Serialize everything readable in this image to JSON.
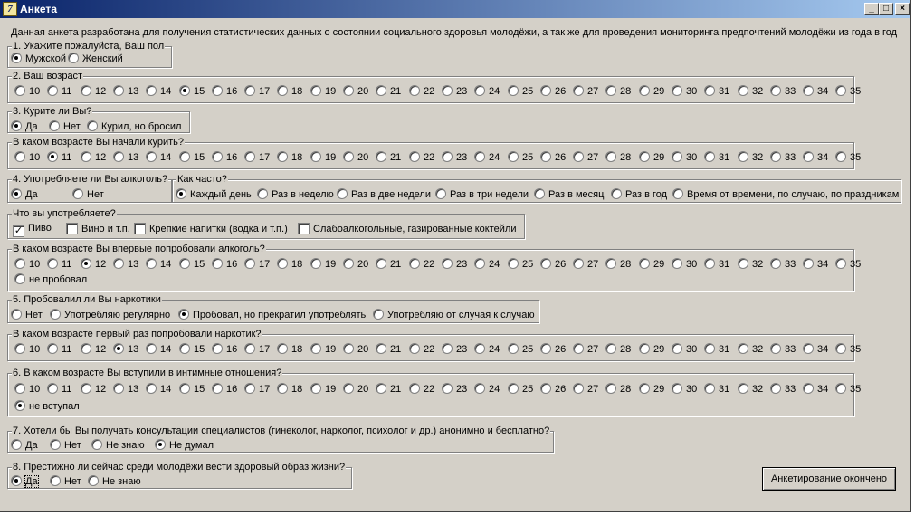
{
  "window": {
    "title": "Анкета",
    "min": "_",
    "max": "□",
    "close": "×"
  },
  "intro": "Данная анкета разработана для получения статистических данных о состоянии социального здоровья молодёжи, а так же для проведения мониторинга предпочтений молодёжи из года в год",
  "q1": {
    "title": "1. Укажите пожалуйста, Ваш пол",
    "options": [
      "Мужской",
      "Женский"
    ],
    "selected": 0
  },
  "q2": {
    "title": "2. Ваш возраст",
    "options": [
      "10",
      "11",
      "12",
      "13",
      "14",
      "15",
      "16",
      "17",
      "18",
      "19",
      "20",
      "21",
      "22",
      "23",
      "24",
      "25",
      "26",
      "27",
      "28",
      "29",
      "30",
      "31",
      "32",
      "33",
      "34",
      "35"
    ],
    "selected": 5
  },
  "q3": {
    "title": "3. Курите ли Вы?",
    "options": [
      "Да",
      "Нет",
      "Курил, но бросил"
    ],
    "selected": 0
  },
  "q3a": {
    "title": "В каком возрасте Вы начали курить?",
    "options": [
      "10",
      "11",
      "12",
      "13",
      "14",
      "15",
      "16",
      "17",
      "18",
      "19",
      "20",
      "21",
      "22",
      "23",
      "24",
      "25",
      "26",
      "27",
      "28",
      "29",
      "30",
      "31",
      "32",
      "33",
      "34",
      "35"
    ],
    "selected": 1
  },
  "q4": {
    "title": "4. Употребляете ли Вы алкоголь?",
    "options": [
      "Да",
      "Нет"
    ],
    "selected": 0
  },
  "q4a": {
    "title": "Как часто?",
    "options": [
      "Каждый день",
      "Раз в неделю",
      "Раз в две недели",
      "Раз в три недели",
      "Раз в месяц",
      "Раз в год",
      "Время от времени, по случаю, по праздникам"
    ],
    "selected": 0
  },
  "q4b": {
    "title": "Что вы употребляете?",
    "options": [
      {
        "label": "Пиво",
        "checked": true
      },
      {
        "label": "Вино и т.п.",
        "checked": false
      },
      {
        "label": "Крепкие напитки (водка и т.п.)",
        "checked": false
      },
      {
        "label": "Слабоалкогольные, газированные коктейли",
        "checked": false
      }
    ]
  },
  "q4c": {
    "title": "В каком возрасте Вы впервые попробовали алкоголь?",
    "options": [
      "10",
      "11",
      "12",
      "13",
      "14",
      "15",
      "16",
      "17",
      "18",
      "19",
      "20",
      "21",
      "22",
      "23",
      "24",
      "25",
      "26",
      "27",
      "28",
      "29",
      "30",
      "31",
      "32",
      "33",
      "34",
      "35"
    ],
    "extra": "не пробовал",
    "selected": 2
  },
  "q5": {
    "title": "5. Пробовалил ли Вы наркотики",
    "options": [
      "Нет",
      "Употребляю регулярно",
      "Пробовал, но прекратил употреблять",
      "Употребляю от случая к случаю"
    ],
    "selected": 2
  },
  "q5a": {
    "title": "В каком возрасте первый раз попробовали наркотик?",
    "options": [
      "10",
      "11",
      "12",
      "13",
      "14",
      "15",
      "16",
      "17",
      "18",
      "19",
      "20",
      "21",
      "22",
      "23",
      "24",
      "25",
      "26",
      "27",
      "28",
      "29",
      "30",
      "31",
      "32",
      "33",
      "34",
      "35"
    ],
    "selected": 3
  },
  "q6": {
    "title": "6. В каком возрасте Вы вступили в интимные отношения?",
    "options": [
      "10",
      "11",
      "12",
      "13",
      "14",
      "15",
      "16",
      "17",
      "18",
      "19",
      "20",
      "21",
      "22",
      "23",
      "24",
      "25",
      "26",
      "27",
      "28",
      "29",
      "30",
      "31",
      "32",
      "33",
      "34",
      "35"
    ],
    "extra": "не вступал",
    "selected": 26
  },
  "q7": {
    "title": "7. Хотели бы Вы получать консультации специалистов (гинеколог, нарколог, психолог и др.) анонимно и бесплатно?",
    "options": [
      "Да",
      "Нет",
      "Не знаю",
      "Не думал"
    ],
    "selected": 3
  },
  "q8": {
    "title": "8. Престижно ли сейчас среди молодёжи вести здоровый образ  жизни?",
    "options": [
      "Да",
      "Нет",
      "Не знаю"
    ],
    "selected": 0
  },
  "finish_button": "Анкетирование окончено"
}
